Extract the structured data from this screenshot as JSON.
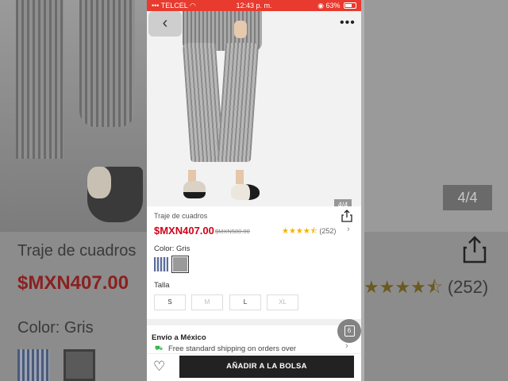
{
  "background": {
    "title": "Traje de cuadros",
    "price": "$MXN407.00",
    "color_label": "Color: Gris",
    "image_counter": "4/4",
    "rating_count": "(252)"
  },
  "status_bar": {
    "carrier": "TELCEL",
    "time": "12:43 p. m.",
    "battery": "63%"
  },
  "image": {
    "counter": "4/4"
  },
  "nav": {
    "back_icon": "chevron-left-icon",
    "more_label": "•••"
  },
  "product": {
    "title": "Traje de cuadros",
    "price": "$MXN407.00",
    "old_price": "$MXN580.00",
    "stars": "★★★★⯪",
    "rating": 4.5,
    "rating_count": "(252)",
    "color_label": "Color: Gris",
    "size_label": "Talla",
    "sizes": [
      {
        "label": "S",
        "available": true
      },
      {
        "label": "M",
        "available": false
      },
      {
        "label": "L",
        "available": true
      },
      {
        "label": "XL",
        "available": false
      }
    ]
  },
  "shipping": {
    "title": "Envío a México",
    "text": "Free standard shipping on orders over"
  },
  "cart": {
    "count": "6"
  },
  "actions": {
    "add_to_bag": "AÑADIR A LA BOLSA"
  },
  "colors": {
    "status_bar": "#e83a2e",
    "price": "#d0021b",
    "star": "#f5b300",
    "add_button": "#222222"
  }
}
